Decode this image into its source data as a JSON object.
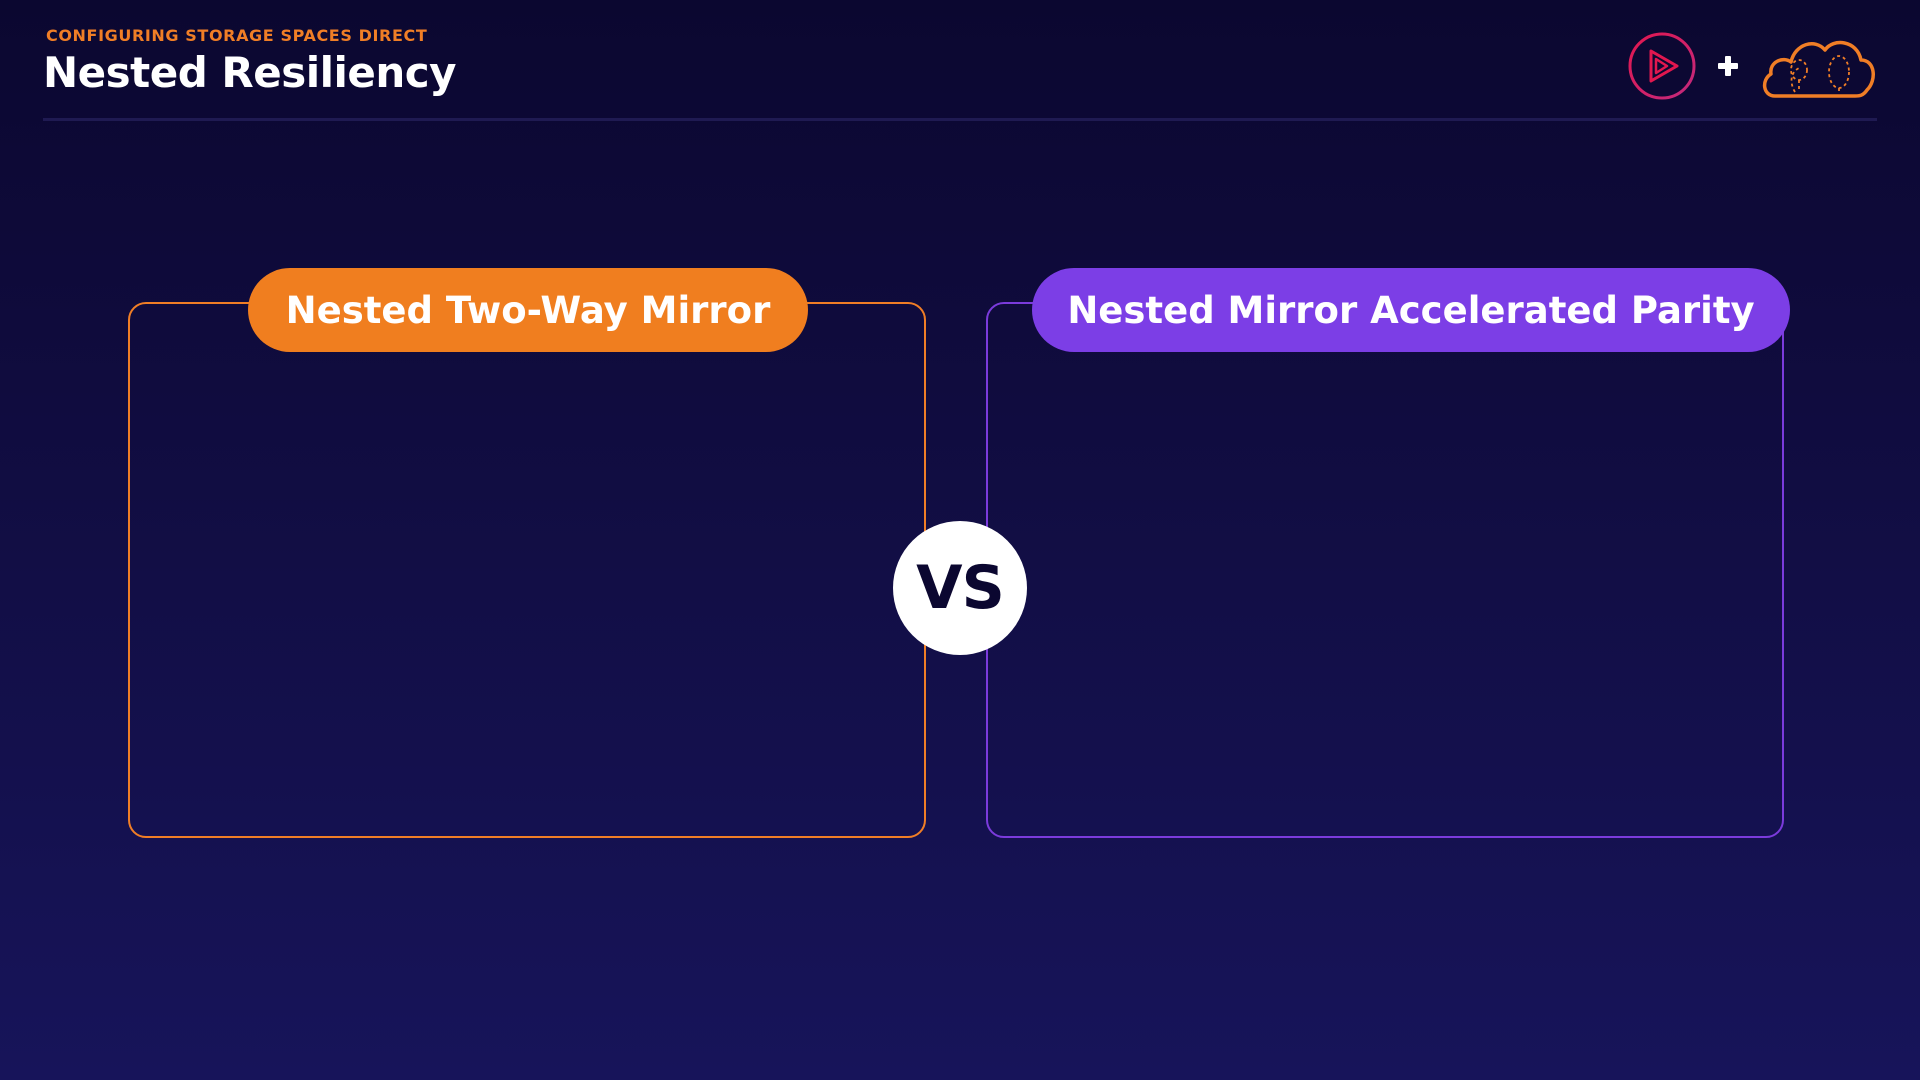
{
  "header": {
    "eyebrow": "CONFIGURING STORAGE SPACES DIRECT",
    "title": "Nested Resiliency"
  },
  "logos": {
    "left_icon": "play-logo-icon",
    "separator_icon": "plus-icon",
    "right_icon": "cloud-tree-logo-icon"
  },
  "comparison": {
    "left_label": "Nested Two-Way Mirror",
    "right_label": "Nested Mirror Accelerated Parity",
    "vs_label": "VS"
  },
  "colors": {
    "accent_orange": "#f07e1f",
    "accent_purple": "#7c3ee6",
    "logo_red": "#e01f50",
    "background_top": "#0b0730",
    "background_bottom": "#17145a"
  }
}
